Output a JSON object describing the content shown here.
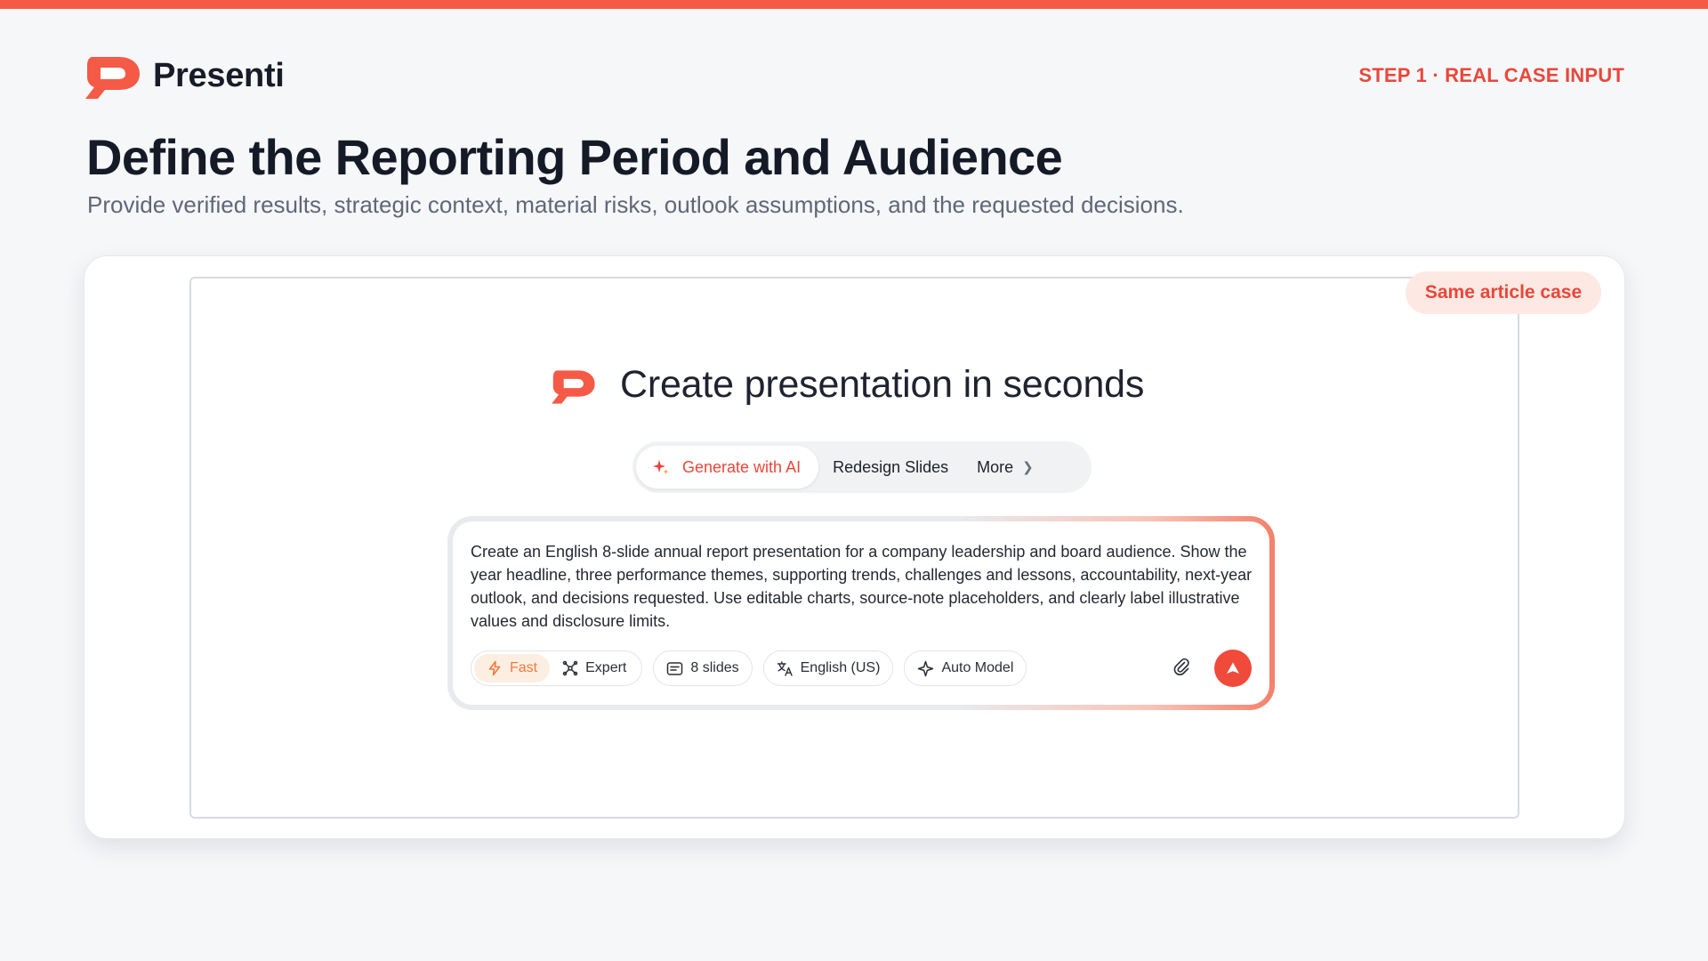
{
  "brand": {
    "name": "Presenti",
    "accent_color": "#f45a46"
  },
  "header": {
    "step_tag": "STEP 1 · REAL CASE INPUT",
    "title": "Define the Reporting Period and Audience",
    "subtitle": "Provide verified results, strategic context, material risks, outlook assumptions, and the requested decisions."
  },
  "badge": {
    "label": "Same article case"
  },
  "app": {
    "hero_title": "Create presentation in seconds",
    "tabs": [
      {
        "label": "Generate with AI",
        "icon": "sparkle-icon",
        "active": true
      },
      {
        "label": "Redesign Slides",
        "active": false
      },
      {
        "label": "More",
        "icon": "chevron-right-icon",
        "active": false
      }
    ],
    "prompt_text": "Create an English 8-slide annual report presentation for a company leadership and board audience. Show the year headline, three performance themes, supporting trends, challenges and lessons, accountability, next-year outlook, and decisions requested. Use editable charts, source-note placeholders, and clearly label illustrative values and disclosure limits.",
    "modes": [
      {
        "label": "Fast",
        "icon": "lightning-icon",
        "active": true
      },
      {
        "label": "Expert",
        "icon": "expert-icon",
        "active": false
      }
    ],
    "options": {
      "slides": {
        "label": "8 slides",
        "icon": "slides-icon"
      },
      "language": {
        "label": "English (US)",
        "icon": "translate-icon"
      },
      "model": {
        "label": "Auto Model",
        "icon": "sparkle-outline-icon"
      }
    },
    "attach_icon": "paperclip-icon",
    "send_icon": "arrow-up-icon"
  }
}
